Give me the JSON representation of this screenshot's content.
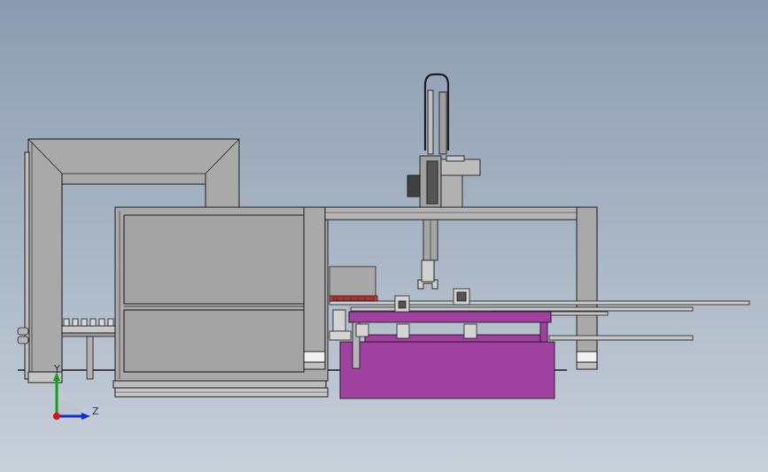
{
  "viewport": {
    "background_top": "#8c9cb0",
    "background_bottom": "#c8d0da"
  },
  "colors": {
    "frame_fill": "#a9a9a9",
    "frame_edge": "#1e1e1e",
    "table_fill": "#a040a0",
    "rail_fill": "#bdbdbd",
    "gantry_fill": "#b5b5b5",
    "accent_red": "#b03030",
    "axis_x": "#d01818",
    "axis_y": "#10a020",
    "axis_z": "#1030d0"
  },
  "triad": {
    "y_label": "Y",
    "z_label": "Z"
  }
}
